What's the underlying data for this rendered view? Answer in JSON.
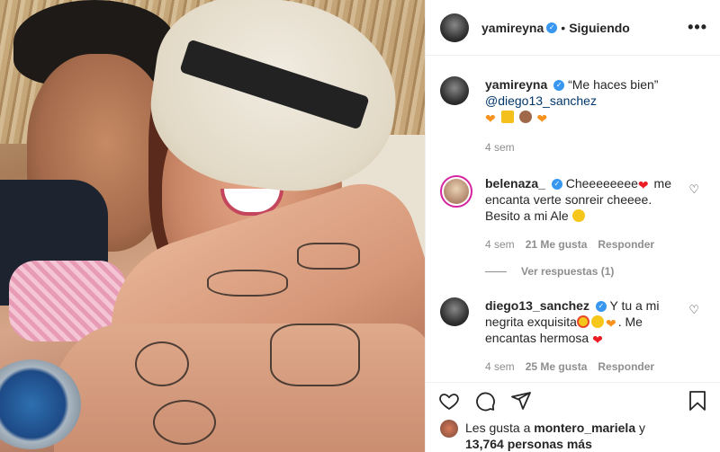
{
  "header": {
    "username": "yamireyna",
    "separator": "•",
    "follow_status": "Siguiendo",
    "more_label": "•••"
  },
  "caption": {
    "username": "yamireyna",
    "text": "“Me haces bien”",
    "mention": "@diego13_sanchez",
    "time": "4 sem"
  },
  "comments": [
    {
      "username": "belenaza_",
      "text_part1": "Cheeeeeeee",
      "text_part2": " me encanta verte sonreir cheeee. Besito a mi Ale",
      "time": "4 sem",
      "likes": "21 Me gusta",
      "reply_label": "Responder",
      "view_replies": "Ver respuestas (1)"
    },
    {
      "username": "diego13_sanchez",
      "text_part1": "Y tu a mi negrita exquisita",
      "text_part2": ". Me encantas hermosa",
      "time": "4 sem",
      "likes": "25 Me gusta",
      "reply_label": "Responder"
    }
  ],
  "likes": {
    "prefix": "Les gusta a ",
    "user": "montero_mariela",
    "middle": " y",
    "count": "13,764 personas más"
  },
  "colors": {
    "verified": "#3897f0",
    "link": "#00376b",
    "muted": "#8e8e8e",
    "text": "#262626"
  }
}
